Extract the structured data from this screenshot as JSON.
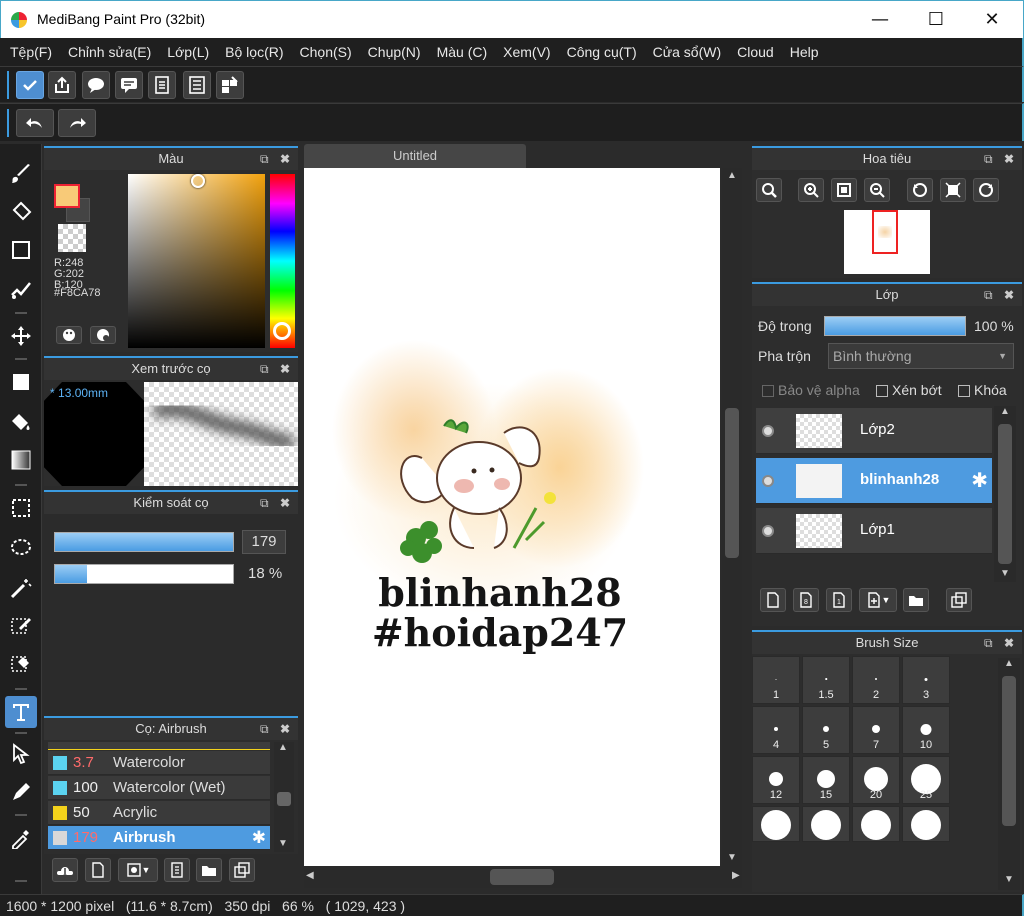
{
  "window": {
    "title": "MediBang Paint Pro (32bit)",
    "minimize": "—",
    "maximize": "☐",
    "close": "✕"
  },
  "menu": [
    "Tệp(F)",
    "Chỉnh sửa(E)",
    "Lớp(L)",
    "Bộ lọc(R)",
    "Chọn(S)",
    "Chụp(N)",
    "Màu (C)",
    "Xem(V)",
    "Công cụ(T)",
    "Cửa sổ(W)",
    "Cloud",
    "Help"
  ],
  "color_panel": {
    "title": "Màu",
    "primary": "#F8CA78",
    "r": "R:248",
    "g": "G:202",
    "b": "B:120",
    "hex": "#F8CA78"
  },
  "brush_preview": {
    "title": "Xem trước cọ",
    "size": "13.00mm"
  },
  "brush_control": {
    "title": "Kiểm soát cọ",
    "size_value": "179",
    "opacity_value": "18 %",
    "size_fill": 1.0,
    "opacity_fill": 0.18
  },
  "brush_list": {
    "title": "Cọ: Airbrush",
    "items": [
      {
        "swatch": "#5bd3f0",
        "value": "3.7",
        "name": "Watercolor",
        "value_color": "#ff6b6b"
      },
      {
        "swatch": "#5bd3f0",
        "value": "100",
        "name": "Watercolor (Wet)",
        "value_color": "#eeeeee"
      },
      {
        "swatch": "#f3d21b",
        "value": "50",
        "name": "Acrylic",
        "value_color": "#eeeeee"
      },
      {
        "swatch": "#d8d8d8",
        "value": "179",
        "name": "Airbrush",
        "value_color": "#ff6b6b"
      }
    ]
  },
  "document": {
    "tab": "Untitled",
    "text_line1": "blinhanh28",
    "text_line2": "#hoidap247"
  },
  "navigator": {
    "title": "Hoa tiêu"
  },
  "layers": {
    "title": "Lớp",
    "opacity_label": "Độ trong",
    "opacity_value": "100 %",
    "opacity_fill": 1.0,
    "blend_label": "Pha trộn",
    "blend_value": "Bình thường",
    "protect_alpha": "Bảo vệ alpha",
    "clipping": "Xén bớt",
    "lock": "Khóa",
    "items": [
      {
        "name": "Lớp2",
        "selected": false
      },
      {
        "name": "blinhanh28",
        "selected": true
      },
      {
        "name": "Lớp1",
        "selected": false
      }
    ]
  },
  "brush_size": {
    "title": "Brush Size",
    "sizes": [
      {
        "label": "1",
        "d": 1
      },
      {
        "label": "1.5",
        "d": 1.5
      },
      {
        "label": "2",
        "d": 2
      },
      {
        "label": "3",
        "d": 3
      },
      {
        "label": "4",
        "d": 4
      },
      {
        "label": "5",
        "d": 6
      },
      {
        "label": "7",
        "d": 8
      },
      {
        "label": "10",
        "d": 11
      },
      {
        "label": "12",
        "d": 14
      },
      {
        "label": "15",
        "d": 18
      },
      {
        "label": "20",
        "d": 24
      },
      {
        "label": "25",
        "d": 30
      },
      {
        "label": "",
        "d": 30
      },
      {
        "label": "",
        "d": 30
      },
      {
        "label": "",
        "d": 30
      },
      {
        "label": "",
        "d": 30
      }
    ]
  },
  "status": {
    "pixels": "1600 * 1200 pixel",
    "cm": "(11.6 * 8.7cm)",
    "dpi": "350 dpi",
    "zoom": "66 %",
    "coords": "( 1029, 423 )"
  }
}
